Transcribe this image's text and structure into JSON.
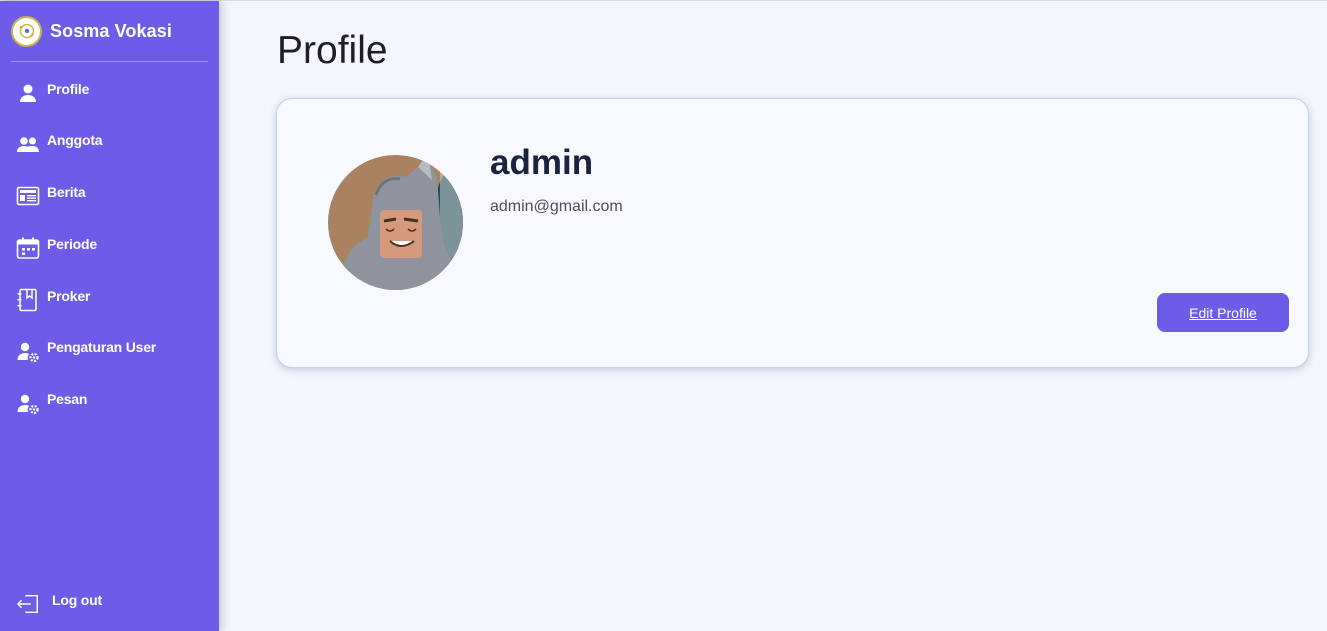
{
  "sidebar": {
    "brand": "Sosma Vokasi",
    "items": [
      {
        "label": "Profile",
        "icon": "user-icon"
      },
      {
        "label": "Anggota",
        "icon": "users-icon"
      },
      {
        "label": "Berita",
        "icon": "newspaper-icon"
      },
      {
        "label": "Periode",
        "icon": "calendar-icon"
      },
      {
        "label": "Proker",
        "icon": "notebook-icon"
      },
      {
        "label": "Pengaturan User",
        "icon": "user-gear-icon"
      },
      {
        "label": "Pesan",
        "icon": "user-gear-icon"
      }
    ],
    "logout": "Log out"
  },
  "main": {
    "title": "Profile",
    "profile": {
      "username": "admin",
      "email": "admin@gmail.com",
      "edit_label": "Edit Profile"
    }
  },
  "colors": {
    "accent": "#6c5ce7",
    "background": "#f3f6fd",
    "card": "#f8f9fe"
  }
}
